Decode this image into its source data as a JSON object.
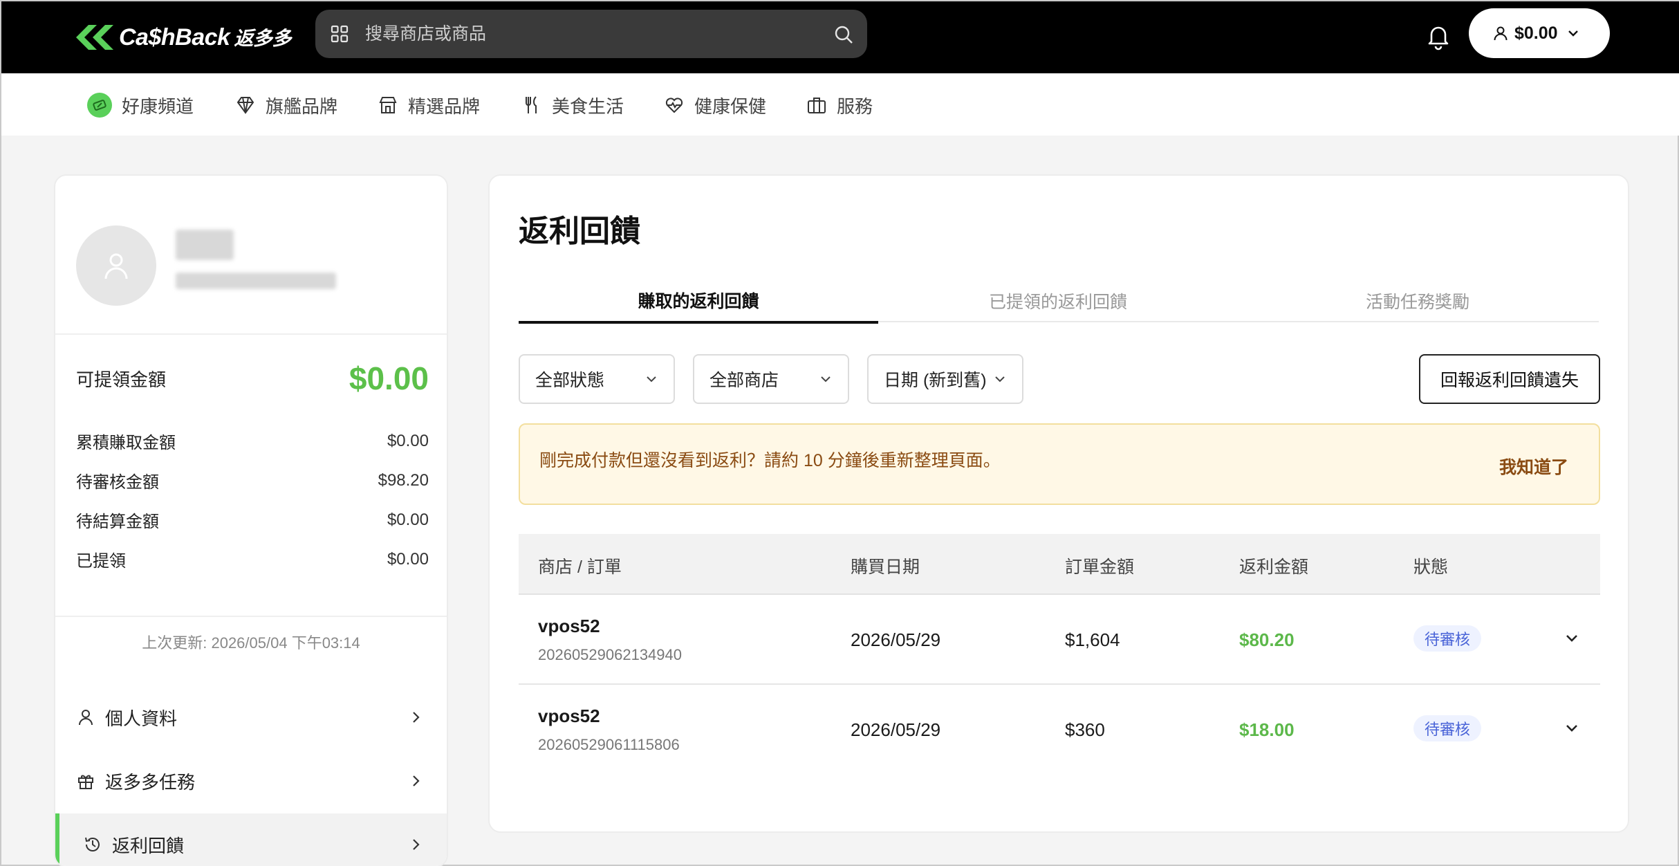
{
  "header": {
    "logo_text": "Ca$hBack",
    "logo_cjk": "返多多",
    "search_placeholder": "搜尋商店或商品",
    "wallet_amount": "$0.00"
  },
  "categories": [
    {
      "label": "好康頻道",
      "icon": "coupon-icon"
    },
    {
      "label": "旗艦品牌",
      "icon": "diamond-icon"
    },
    {
      "label": "精選品牌",
      "icon": "store-icon"
    },
    {
      "label": "美食生活",
      "icon": "fork-knife-icon"
    },
    {
      "label": "健康保健",
      "icon": "heart-pulse-icon"
    },
    {
      "label": "服務",
      "icon": "briefcase-icon"
    }
  ],
  "sidebar": {
    "available_label": "可提領金額",
    "available_value": "$0.00",
    "stats": [
      {
        "label": "累積賺取金額",
        "value": "$0.00"
      },
      {
        "label": "待審核金額",
        "value": "$98.20"
      },
      {
        "label": "待結算金額",
        "value": "$0.00"
      },
      {
        "label": "已提領",
        "value": "$0.00"
      }
    ],
    "updated": "上次更新: 2026/05/04 下午03:14",
    "menu": [
      {
        "label": "個人資料",
        "icon": "user-icon"
      },
      {
        "label": "返多多任務",
        "icon": "gift-icon"
      },
      {
        "label": "返利回饋",
        "icon": "history-icon"
      }
    ]
  },
  "main": {
    "title": "返利回饋",
    "tabs": [
      "賺取的返利回饋",
      "已提領的返利回饋",
      "活動任務獎勵"
    ],
    "filters": [
      "全部狀態",
      "全部商店",
      "日期 (新到舊)"
    ],
    "report_button": "回報返利回饋遺失",
    "notice": "剛完成付款但還沒看到返利？請約 10 分鐘後重新整理頁面。",
    "notice_ok": "我知道了",
    "table": {
      "headers": [
        "商店 / 訂單",
        "購買日期",
        "訂單金額",
        "返利金額",
        "狀態"
      ],
      "rows": [
        {
          "store": "vpos52",
          "order": "20260529062134940",
          "date": "2026/05/29",
          "amount": "$1,604",
          "cashback": "$80.20",
          "status": "待審核"
        },
        {
          "store": "vpos52",
          "order": "20260529061115806",
          "date": "2026/05/29",
          "amount": "$360",
          "cashback": "$18.00",
          "status": "待審核"
        }
      ]
    }
  },
  "colors": {
    "accent_green": "#5cc04a",
    "notice_bg": "#fff8e6",
    "status_blue": "#4a64d8"
  }
}
